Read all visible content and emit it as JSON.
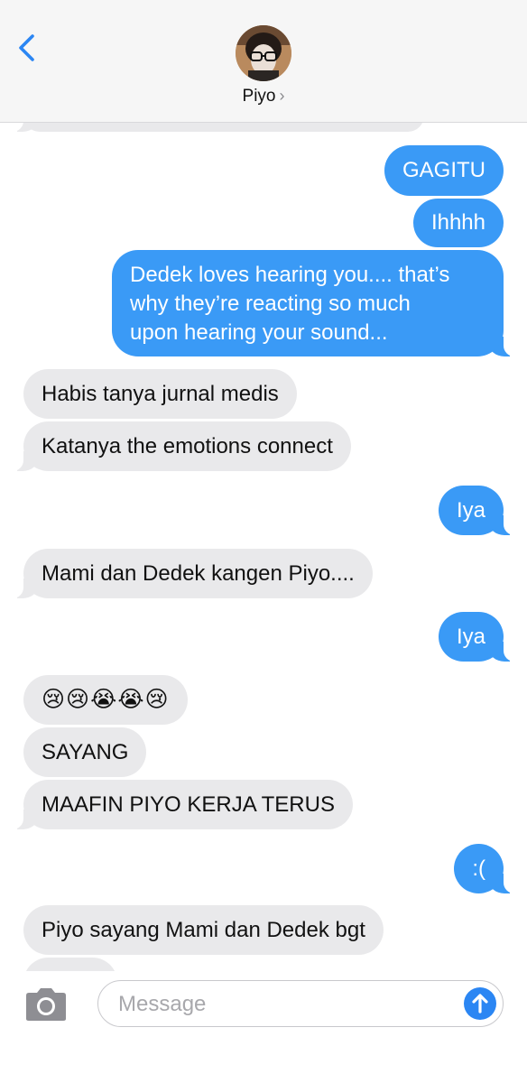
{
  "header": {
    "contact_name": "Piyo",
    "chevron": "›"
  },
  "messages": [
    {
      "id": "m1",
      "side": "out",
      "text": "GAGITU"
    },
    {
      "id": "m2",
      "side": "out",
      "text": "Ihhhh"
    },
    {
      "id": "m3",
      "side": "out",
      "lines": [
        "Dedek loves hearing you.... that’s",
        "why they’re reacting so much",
        "upon hearing your sound..."
      ]
    },
    {
      "id": "m4",
      "side": "in",
      "text": "Habis tanya jurnal medis"
    },
    {
      "id": "m5",
      "side": "in",
      "text": "Katanya the emotions connect"
    },
    {
      "id": "m6",
      "side": "out",
      "text": "Iya"
    },
    {
      "id": "m7",
      "side": "in",
      "text": "Mami dan Dedek kangen Piyo...."
    },
    {
      "id": "m8",
      "side": "out",
      "text": "Iya"
    },
    {
      "id": "m9",
      "side": "in",
      "text": "😢😢😭😭😢"
    },
    {
      "id": "m10",
      "side": "in",
      "text": "SAYANG"
    },
    {
      "id": "m11",
      "side": "in",
      "text": "MAAFIN PIYO KERJA TERUS"
    },
    {
      "id": "m12",
      "side": "out",
      "text": ":("
    },
    {
      "id": "m13",
      "side": "in",
      "text": "Piyo sayang Mami dan Dedek bgt"
    }
  ],
  "input": {
    "placeholder": "Message",
    "value": ""
  },
  "icons": {
    "back": "chevron-left-icon",
    "camera": "camera-icon",
    "send": "arrow-up-icon"
  },
  "colors": {
    "outgoing_bubble": "#3a9af6",
    "incoming_bubble": "#e9e9eb",
    "accent": "#2b86f3"
  }
}
